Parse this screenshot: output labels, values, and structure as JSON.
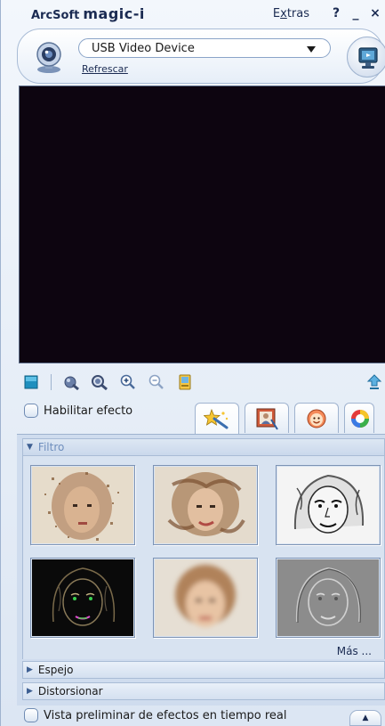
{
  "app": {
    "brand_a": "ArcSoft",
    "brand_b": "magic-i",
    "extras_prefix": "E",
    "extras_underlined": "x",
    "extras_suffix": "tras",
    "help": "?",
    "minimize": "_",
    "close": "×"
  },
  "device": {
    "selected": "USB Video Device",
    "refresh_label": "Refrescar"
  },
  "controls": {
    "enable_effect_label": "Habilitar efecto",
    "enable_effect_checked": false,
    "realtime_preview_label": "Vista preliminar de efectos en tiempo real",
    "realtime_preview_checked": false
  },
  "toolbar_icons": [
    "stop-icon",
    "color-settings-icon",
    "zoom-settings-icon",
    "zoom-in-icon",
    "zoom-out-icon",
    "snapshot-icon",
    "upload-icon"
  ],
  "tabs": [
    {
      "icon": "star-wand-icon",
      "active": true
    },
    {
      "icon": "portrait-frame-icon",
      "active": false
    },
    {
      "icon": "smiley-icon",
      "active": false
    },
    {
      "icon": "color-wheel-icon",
      "active": false
    }
  ],
  "effects": {
    "categories": [
      {
        "label": "Filtro",
        "expanded": true
      },
      {
        "label": "Espejo",
        "expanded": false
      },
      {
        "label": "Distorsionar",
        "expanded": false
      }
    ],
    "filters": [
      {
        "name": "scatter-filter"
      },
      {
        "name": "swirl-filter"
      },
      {
        "name": "sketch-filter"
      },
      {
        "name": "neon-edge-filter"
      },
      {
        "name": "blur-filter"
      },
      {
        "name": "emboss-filter"
      }
    ],
    "more_label": "Más ..."
  },
  "colors": {
    "accent": "#1b2b52",
    "preview_bg": "#0d0510",
    "panel_bg": "#cfdcee"
  }
}
